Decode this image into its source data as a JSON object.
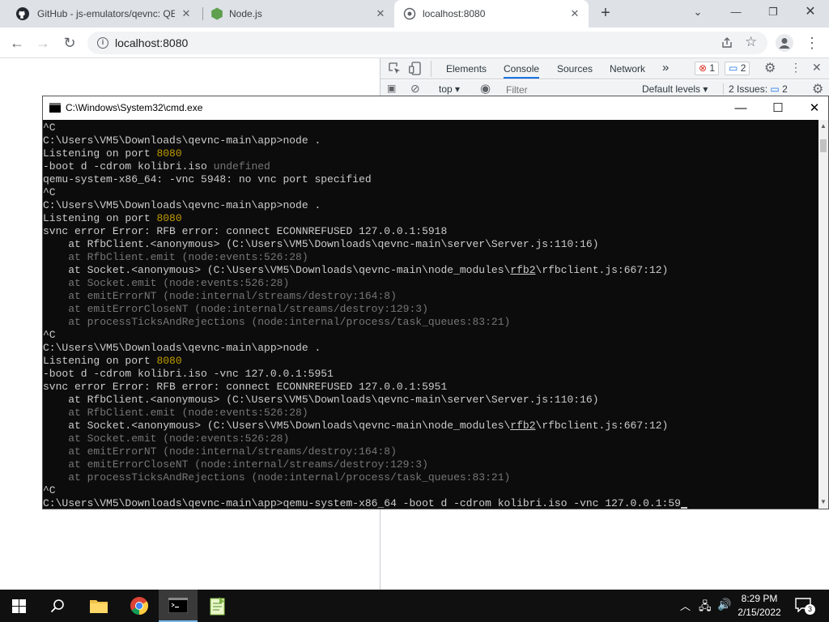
{
  "browser": {
    "tabs": [
      {
        "title": "GitHub - js-emulators/qevnc: QE",
        "icon": "github-icon",
        "active": false
      },
      {
        "title": "Node.js",
        "icon": "nodejs-icon",
        "active": false
      },
      {
        "title": "localhost:8080",
        "icon": "globe-icon",
        "active": true
      }
    ],
    "new_tab": "+",
    "address": "localhost:8080"
  },
  "devtools": {
    "tabs": [
      "Elements",
      "Console",
      "Sources",
      "Network"
    ],
    "more": "»",
    "errors": "1",
    "messages": "2",
    "context": "top",
    "filter_placeholder": "Filter",
    "levels": "Default levels",
    "issues_label": "2 Issues:",
    "issues_count": "2"
  },
  "cmd": {
    "title": "C:\\Windows\\System32\\cmd.exe",
    "lines": [
      [
        {
          "t": "^C"
        }
      ],
      [
        {
          "t": "C:\\Users\\VM5\\Downloads\\qevnc-main\\app>node ."
        }
      ],
      [
        {
          "t": "Listening on port "
        },
        {
          "t": "8080",
          "c": "yel"
        }
      ],
      [
        {
          "t": "-boot d -cdrom kolibri.iso "
        },
        {
          "t": "undefined",
          "c": "dim"
        }
      ],
      [
        {
          "t": "qemu-system-x86_64: -vnc 5948: no vnc port specified"
        }
      ],
      [
        {
          "t": "^C"
        }
      ],
      [
        {
          "t": "C:\\Users\\VM5\\Downloads\\qevnc-main\\app>node ."
        }
      ],
      [
        {
          "t": "Listening on port "
        },
        {
          "t": "8080",
          "c": "yel"
        }
      ],
      [
        {
          "t": "svnc error Error: RFB error: connect ECONNREFUSED 127.0.0.1:5918"
        }
      ],
      [
        {
          "t": "    at RfbClient.<anonymous> (C:\\Users\\VM5\\Downloads\\qevnc-main\\server\\Server.js:110:16)"
        }
      ],
      [
        {
          "t": "    at RfbClient.emit (node:events:526:28)",
          "c": "dim"
        }
      ],
      [
        {
          "t": "    at Socket.<anonymous> (C:\\Users\\VM5\\Downloads\\qevnc-main\\node_modules\\"
        },
        {
          "t": "rfb2",
          "c": "und"
        },
        {
          "t": "\\rfbclient.js:667:12)"
        }
      ],
      [
        {
          "t": "    at Socket.emit (node:events:526:28)",
          "c": "dim"
        }
      ],
      [
        {
          "t": "    at emitErrorNT (node:internal/streams/destroy:164:8)",
          "c": "dim"
        }
      ],
      [
        {
          "t": "    at emitErrorCloseNT (node:internal/streams/destroy:129:3)",
          "c": "dim"
        }
      ],
      [
        {
          "t": "    at processTicksAndRejections (node:internal/process/task_queues:83:21)",
          "c": "dim"
        }
      ],
      [
        {
          "t": "^C"
        }
      ],
      [
        {
          "t": "C:\\Users\\VM5\\Downloads\\qevnc-main\\app>node ."
        }
      ],
      [
        {
          "t": "Listening on port "
        },
        {
          "t": "8080",
          "c": "yel"
        }
      ],
      [
        {
          "t": "-boot d -cdrom kolibri.iso -vnc 127.0.0.1:5951"
        }
      ],
      [
        {
          "t": "svnc error Error: RFB error: connect ECONNREFUSED 127.0.0.1:5951"
        }
      ],
      [
        {
          "t": "    at RfbClient.<anonymous> (C:\\Users\\VM5\\Downloads\\qevnc-main\\server\\Server.js:110:16)"
        }
      ],
      [
        {
          "t": "    at RfbClient.emit (node:events:526:28)",
          "c": "dim"
        }
      ],
      [
        {
          "t": "    at Socket.<anonymous> (C:\\Users\\VM5\\Downloads\\qevnc-main\\node_modules\\"
        },
        {
          "t": "rfb2",
          "c": "und"
        },
        {
          "t": "\\rfbclient.js:667:12)"
        }
      ],
      [
        {
          "t": "    at Socket.emit (node:events:526:28)",
          "c": "dim"
        }
      ],
      [
        {
          "t": "    at emitErrorNT (node:internal/streams/destroy:164:8)",
          "c": "dim"
        }
      ],
      [
        {
          "t": "    at emitErrorCloseNT (node:internal/streams/destroy:129:3)",
          "c": "dim"
        }
      ],
      [
        {
          "t": "    at processTicksAndRejections (node:internal/process/task_queues:83:21)",
          "c": "dim"
        }
      ],
      [
        {
          "t": "^C"
        }
      ],
      [
        {
          "t": "C:\\Users\\VM5\\Downloads\\qevnc-main\\app>qemu-system-x86_64 -boot d -cdrom kolibri.iso -vnc 127.0.0.1:59"
        }
      ]
    ]
  },
  "taskbar": {
    "time": "8:29 PM",
    "date": "2/15/2022",
    "notifications": "3",
    "apps": [
      "file-explorer-icon",
      "chrome-icon",
      "cmd-icon",
      "notepad-plus-plus-icon"
    ]
  },
  "colors": {
    "console_bg": "#0c0c0c",
    "console_fg": "#cccccc",
    "console_dim": "#767676",
    "console_yellow": "#c19c00",
    "accent": "#1a73e8"
  }
}
